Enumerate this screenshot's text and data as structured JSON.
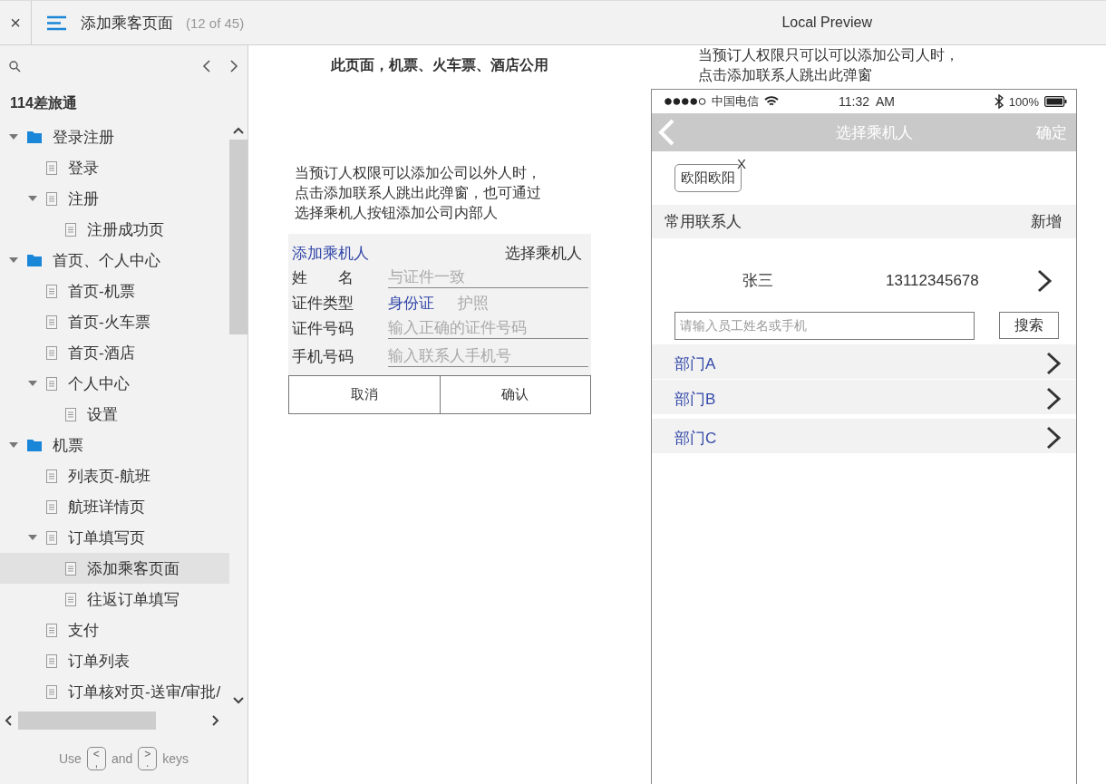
{
  "header": {
    "close": "×",
    "title": "添加乘客页面",
    "counter": "(12 of 45)",
    "preview": "Local Preview"
  },
  "sidebar": {
    "project": "114差旅通",
    "tree": [
      {
        "label": "登录注册",
        "kind": "folder",
        "expanded": true,
        "selected": false,
        "children": [
          {
            "label": "登录",
            "kind": "page",
            "selected": false
          },
          {
            "label": "注册",
            "kind": "page",
            "expanded": true,
            "selected": false,
            "children": [
              {
                "label": "注册成功页",
                "kind": "page",
                "selected": false
              }
            ]
          }
        ]
      },
      {
        "label": "首页、个人中心",
        "kind": "folder",
        "expanded": true,
        "selected": false,
        "children": [
          {
            "label": "首页-机票",
            "kind": "page",
            "selected": false
          },
          {
            "label": "首页-火车票",
            "kind": "page",
            "selected": false
          },
          {
            "label": "首页-酒店",
            "kind": "page",
            "selected": false
          },
          {
            "label": "个人中心",
            "kind": "page",
            "expanded": true,
            "selected": false,
            "children": [
              {
                "label": "设置",
                "kind": "page",
                "selected": false
              }
            ]
          }
        ]
      },
      {
        "label": "机票",
        "kind": "folder",
        "expanded": true,
        "selected": false,
        "children": [
          {
            "label": "列表页-航班",
            "kind": "page",
            "selected": false
          },
          {
            "label": "航班详情页",
            "kind": "page",
            "selected": false
          },
          {
            "label": "订单填写页",
            "kind": "page",
            "expanded": true,
            "selected": false,
            "children": [
              {
                "label": "添加乘客页面",
                "kind": "page",
                "selected": true
              },
              {
                "label": "往返订单填写",
                "kind": "page",
                "selected": false
              }
            ]
          },
          {
            "label": "支付",
            "kind": "page",
            "selected": false
          },
          {
            "label": "订单列表",
            "kind": "page",
            "selected": false
          },
          {
            "label": "订单核对页-送审/审批/",
            "kind": "page",
            "selected": false
          }
        ]
      }
    ],
    "hint": {
      "use": "Use",
      "key_prev": {
        "top": "<",
        "bottom": ","
      },
      "and": "and",
      "key_next": {
        "top": ">",
        "bottom": "."
      },
      "keys": "keys"
    }
  },
  "canvas": {
    "heading": "此页面，机票、火车票、酒店公用",
    "note_left": [
      "当预订人权限可以添加公司以外人时，",
      "点击添加联系人跳出此弹窗，也可通过",
      "选择乘机人按钮添加公司内部人"
    ],
    "form": {
      "tabs": [
        {
          "label": "添加乘机人",
          "selected": true
        },
        {
          "label": "选择乘机人",
          "selected": false
        }
      ],
      "rows": [
        {
          "kind": "input",
          "label": "姓　　名",
          "placeholder": "与证件一致"
        },
        {
          "kind": "choice",
          "label": "证件类型",
          "options": [
            {
              "label": "身份证",
              "selected": true
            },
            {
              "label": "护照",
              "selected": false
            }
          ]
        },
        {
          "kind": "input",
          "label": "证件号码",
          "placeholder": "输入正确的证件号码"
        },
        {
          "kind": "input",
          "label": "手机号码",
          "placeholder": "输入联系人手机号"
        }
      ],
      "buttons": [
        "取消",
        "确认"
      ]
    },
    "note_right": [
      "当预订人权限只可以可以添加公司人时，",
      "点击添加联系人跳出此弹窗"
    ],
    "phone": {
      "status": {
        "carrier": "中国电信",
        "time": "11:32  AM",
        "battery": "100%"
      },
      "nav": {
        "title": "选择乘机人",
        "action": "确定"
      },
      "chips": [
        {
          "label": "欧阳欧阳",
          "remove": "X"
        }
      ],
      "section": {
        "title": "常用联系人",
        "action": "新增"
      },
      "contacts": [
        {
          "name": "张三",
          "phone": "13112345678"
        }
      ],
      "search": {
        "placeholder": "请输入员工姓名或手机",
        "button": "搜索"
      },
      "departments": [
        "部门A",
        "部门B",
        "部门C"
      ]
    }
  }
}
